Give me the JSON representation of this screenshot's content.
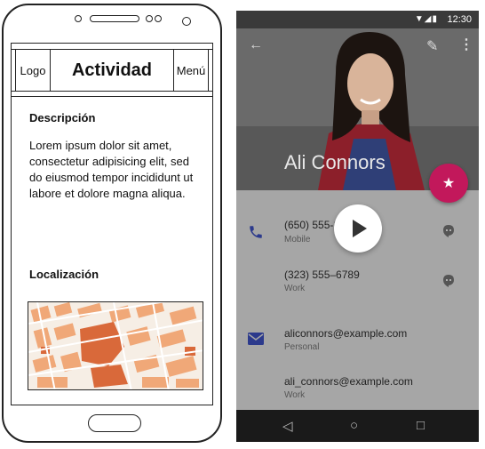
{
  "wireframe": {
    "logo_label": "Logo",
    "title": "Actividad",
    "menu_label": "Menú",
    "description_heading": "Descripción",
    "description_text": "Lorem ipsum dolor sit amet, consectetur adipisicing elit, sed do eiusmod tempor incididunt ut labore et dolore magna aliqua.",
    "location_heading": "Localización"
  },
  "contact_app": {
    "status_time": "12:30",
    "contact_name": "Ali Connors",
    "phones": [
      {
        "number": "(650) 555-1234",
        "label": "Mobile"
      },
      {
        "number": "(323) 555–6789",
        "label": "Work"
      }
    ],
    "emails": [
      {
        "address": "aliconnors@example.com",
        "label": "Personal"
      },
      {
        "address": "ali_connors@example.com",
        "label": "Work"
      }
    ],
    "colors": {
      "fab": "#c2185b",
      "icon_accent": "#2c3a8c"
    }
  }
}
